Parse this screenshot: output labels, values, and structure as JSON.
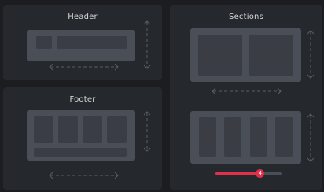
{
  "cards": {
    "header": {
      "title": "Header"
    },
    "footer": {
      "title": "Footer"
    },
    "sections": {
      "title": "Sections"
    }
  },
  "slider": {
    "value": 4,
    "fill_fraction": 0.67,
    "colors": {
      "fill": "#e0314b",
      "track": "#4a4e56"
    }
  },
  "icons": [
    "horizontal-resize-arrow-icon",
    "vertical-resize-arrow-icon"
  ]
}
